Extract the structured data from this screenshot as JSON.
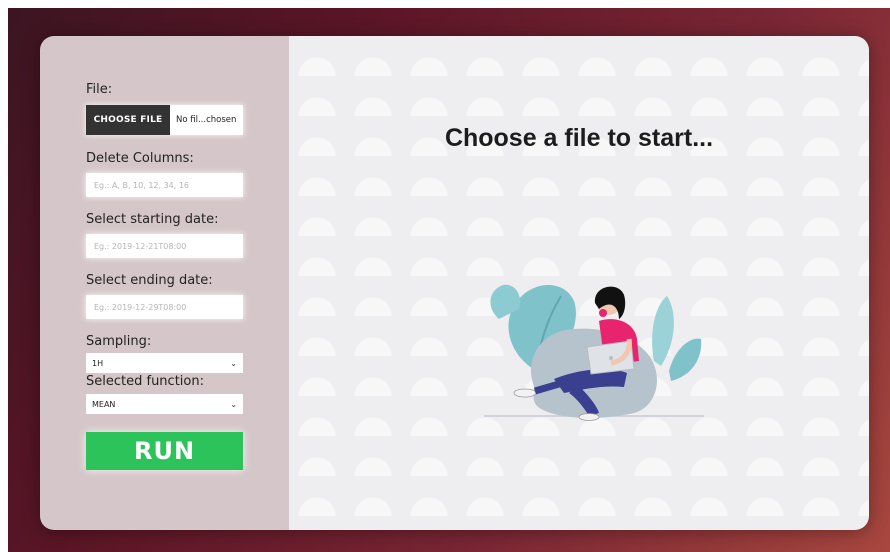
{
  "form": {
    "file_label": "File:",
    "file_button": "CHOOSE FILE",
    "file_status": "No fil...chosen",
    "delete_columns_label": "Delete Columns:",
    "delete_columns_placeholder": "Eg.: A, B, 10, 12, 34, 16",
    "start_date_label": "Select starting date:",
    "start_date_placeholder": "Eg.: 2019-12-21T08:00",
    "end_date_label": "Select ending date:",
    "end_date_placeholder": "Eg.: 2019-12-29T08:00",
    "sampling_label": "Sampling:",
    "sampling_value": "1H",
    "function_label": "Selected function:",
    "function_value": "MEAN",
    "run_label": "RUN"
  },
  "main": {
    "heading": "Choose a file to start..."
  },
  "colors": {
    "run_button": "#2dc35b",
    "sidebar": "#d5c7c9",
    "file_button": "#333333"
  },
  "icons": {
    "select_arrow": "chevron-down-icon",
    "illustration": "person-with-laptop-illustration"
  }
}
